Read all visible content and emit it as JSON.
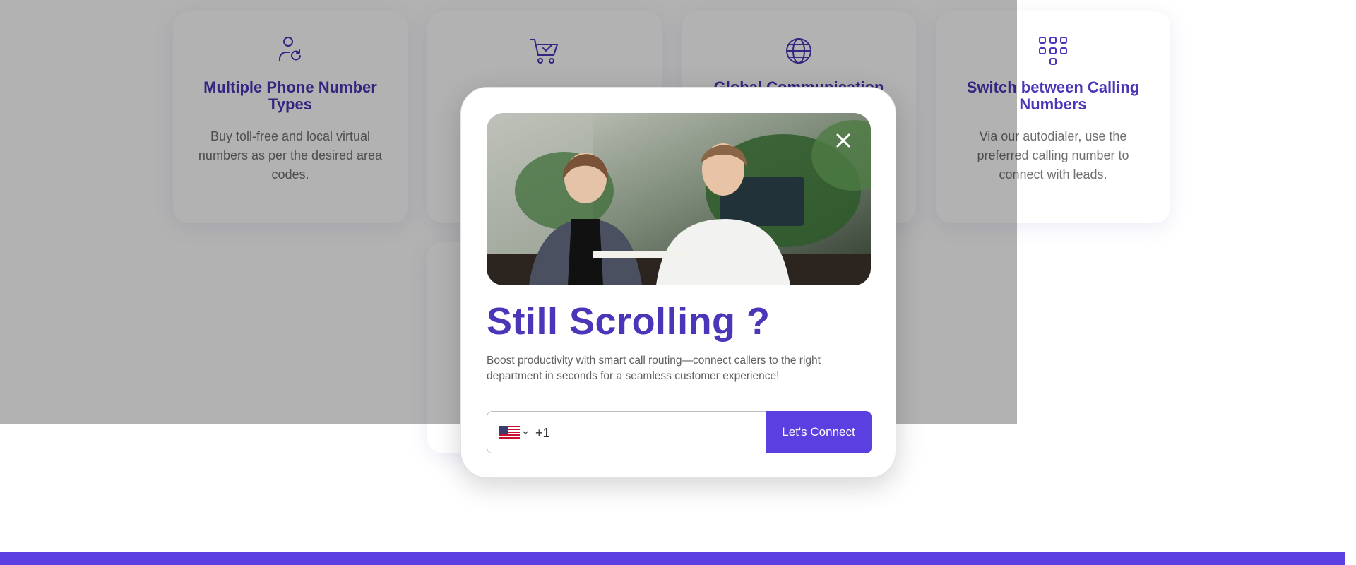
{
  "features": [
    {
      "icon": "user-refresh-icon",
      "title": "Multiple Phone Number Types",
      "description": "Buy toll-free and local virtual numbers as per the desired area codes."
    },
    {
      "icon": "cart-check-icon",
      "title": "",
      "description": ""
    },
    {
      "icon": "globe-icon",
      "title": "Global Communication",
      "description": ""
    },
    {
      "icon": "dialpad-icon",
      "title": "Switch between Calling Numbers",
      "description": "Via our autodialer, use the preferred calling number to connect with leads."
    },
    {
      "icon": "",
      "title": "",
      "description": ""
    }
  ],
  "popup": {
    "image": "two-colleagues-reviewing-document-photo",
    "close_icon": "close-icon",
    "title": "Still Scrolling ?",
    "description": "Boost productivity with smart call routing—connect callers to the right department in seconds for a seamless customer experience!",
    "country_flag": "us-flag-icon",
    "dial_code": "+1",
    "phone_value": "",
    "phone_placeholder": "",
    "cta_label": "Let's Connect"
  },
  "colors": {
    "accent": "#4b35b8",
    "button": "#5b3fe0",
    "footer_band": "#5b3fe0",
    "overlay": "rgba(0,0,0,0.30)"
  }
}
